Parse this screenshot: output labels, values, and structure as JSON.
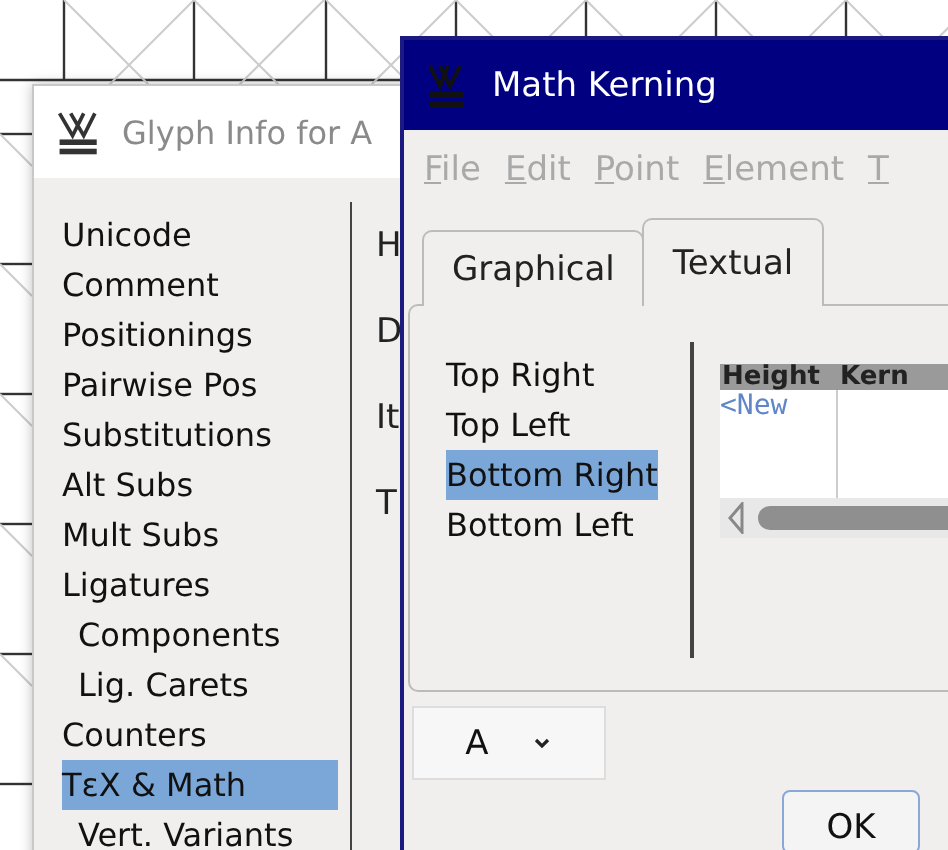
{
  "glyph_info": {
    "title": "Glyph Info for A",
    "items": [
      {
        "label": "Unicode",
        "selected": false
      },
      {
        "label": "Comment",
        "selected": false
      },
      {
        "label": "Positionings",
        "selected": false
      },
      {
        "label": "Pairwise Pos",
        "selected": false
      },
      {
        "label": "Substitutions",
        "selected": false
      },
      {
        "label": "Alt Subs",
        "selected": false
      },
      {
        "label": "Mult Subs",
        "selected": false
      },
      {
        "label": "Ligatures",
        "selected": false,
        "children": [
          {
            "label": "Components",
            "selected": false
          },
          {
            "label": "Lig. Carets",
            "selected": false
          }
        ]
      },
      {
        "label": "Counters",
        "selected": false
      },
      {
        "label": "TεX & Math",
        "selected": true,
        "children": [
          {
            "label": "Vert. Variants",
            "selected": false
          }
        ]
      }
    ],
    "field_labels": [
      "H",
      "D",
      "It",
      "T"
    ]
  },
  "math_kerning": {
    "title": "Math Kerning",
    "menu": [
      "File",
      "Edit",
      "Point",
      "Element",
      "T"
    ],
    "tabs": [
      {
        "label": "Graphical",
        "selected": false
      },
      {
        "label": "Textual",
        "selected": true
      }
    ],
    "corners": [
      {
        "label": "Top Right",
        "selected": false
      },
      {
        "label": "Top Left",
        "selected": false
      },
      {
        "label": "Bottom Right",
        "selected": true
      },
      {
        "label": "Bottom Left",
        "selected": false
      }
    ],
    "table": {
      "columns": [
        "Height",
        "Kern"
      ],
      "rows": [
        [
          "<New"
        ]
      ]
    },
    "glyph_select": {
      "value": "A"
    },
    "buttons": [
      "OK"
    ]
  }
}
